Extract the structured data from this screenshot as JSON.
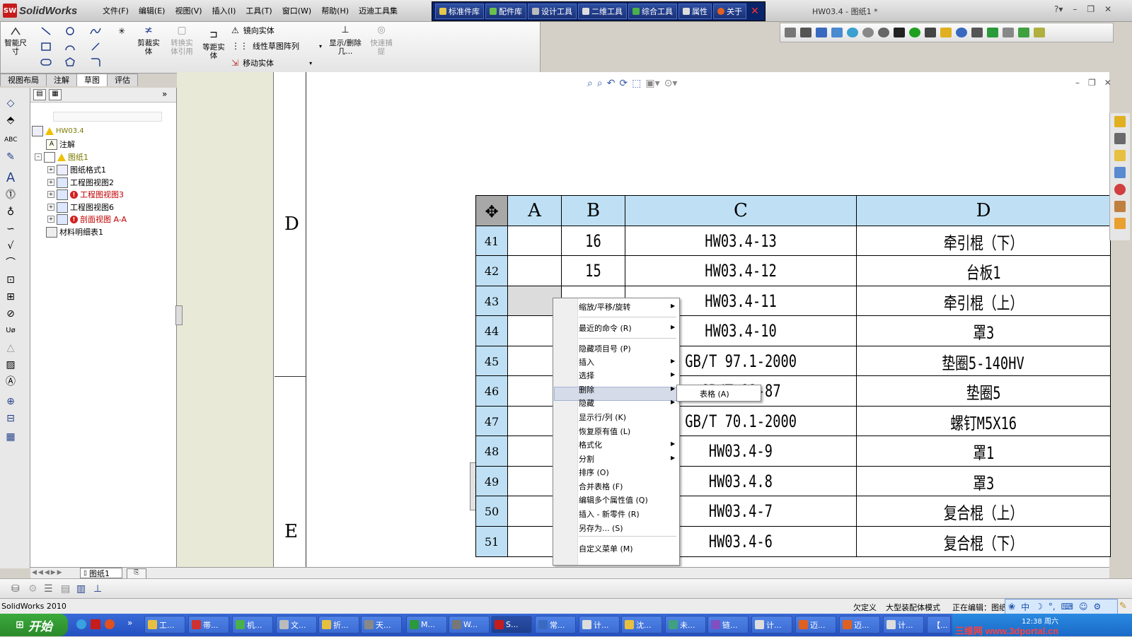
{
  "app": {
    "name": "SolidWorks",
    "doc_title": "HW03.4 - 图纸1 *",
    "menus": [
      "文件(F)",
      "编辑(E)",
      "视图(V)",
      "插入(I)",
      "工具(T)",
      "窗口(W)",
      "帮助(H)",
      "迈迪工具集"
    ],
    "plugin_bar": [
      "标准件库",
      "配件库",
      "设计工具",
      "二维工具",
      "综合工具",
      "属性",
      "关于"
    ]
  },
  "command_manager": {
    "tools": {
      "smart_dim": "智能尺寸",
      "trim": "剪裁实体",
      "convert": "转换实体引用",
      "offset": "等距实体",
      "mirror": "镜向实体",
      "linear_pattern": "线性草图阵列",
      "move": "移动实体",
      "show_delete": "显示/删除几...",
      "quick_snap": "快速捕捉"
    },
    "tabs": [
      "视图布局",
      "注解",
      "草图",
      "评估"
    ],
    "active_tab": "草图"
  },
  "feature_tree": {
    "root": "HW03.4",
    "annotations": "注解",
    "sheet": "图纸1",
    "items": [
      {
        "label": "图纸格式1",
        "state": "normal"
      },
      {
        "label": "工程图视图2",
        "state": "normal"
      },
      {
        "label": "工程图视图3",
        "state": "error"
      },
      {
        "label": "工程图视图6",
        "state": "normal"
      },
      {
        "label": "剖面视图 A-A",
        "state": "error"
      },
      {
        "label": "材料明细表1",
        "state": "normal"
      }
    ]
  },
  "drawing": {
    "zone_letters": [
      "D",
      "E"
    ]
  },
  "bom_table": {
    "columns": [
      "A",
      "B",
      "C",
      "D"
    ],
    "rows": [
      {
        "row": "41",
        "A": "",
        "B": "16",
        "C": "HW03.4-13",
        "D": "牵引棍（下）"
      },
      {
        "row": "42",
        "A": "",
        "B": "15",
        "C": "HW03.4-12",
        "D": "台板1"
      },
      {
        "row": "43",
        "A": "",
        "B": "",
        "C": "HW03.4-11",
        "D": "牵引棍（上）"
      },
      {
        "row": "44",
        "A": "",
        "B": "",
        "C": "HW03.4-10",
        "D": "罩3"
      },
      {
        "row": "45",
        "A": "",
        "B": "",
        "C": "GB/T 97.1-2000",
        "D": "垫圈5-140HV"
      },
      {
        "row": "46",
        "A": "",
        "B": "",
        "C": "GB/T 93-87",
        "D": "垫圈5"
      },
      {
        "row": "47",
        "A": "",
        "B": "",
        "C": "GB/T 70.1-2000",
        "D": "螺钉M5X16"
      },
      {
        "row": "48",
        "A": "",
        "B": "",
        "C": "HW03.4-9",
        "D": "罩1"
      },
      {
        "row": "49",
        "A": "",
        "B": "",
        "C": "HW03.4.8",
        "D": "罩3"
      },
      {
        "row": "50",
        "A": "",
        "B": "",
        "C": "HW03.4-7",
        "D": "复合棍（上）"
      },
      {
        "row": "51",
        "A": "",
        "B": "",
        "C": "HW03.4-6",
        "D": "复合棍（下）"
      }
    ]
  },
  "context_menu": {
    "items": [
      {
        "label": "缩放/平移/旋转",
        "sub": true
      },
      {
        "label": "最近的命令 (R)",
        "sub": true
      },
      {
        "label": "隐藏项目号 (P)",
        "sub": false
      },
      {
        "label": "插入",
        "sub": true
      },
      {
        "label": "选择",
        "sub": true
      },
      {
        "label": "删除",
        "sub": true
      },
      {
        "label": "隐藏",
        "sub": true
      },
      {
        "label": "显示行/列 (K)",
        "sub": false
      },
      {
        "label": "恢复原有值 (L)",
        "sub": false
      },
      {
        "label": "格式化",
        "sub": true
      },
      {
        "label": "分割",
        "sub": true
      },
      {
        "label": "排序 (O)",
        "sub": false
      },
      {
        "label": "合并表格 (F)",
        "sub": false
      },
      {
        "label": "编辑多个属性值 (Q)",
        "sub": false
      },
      {
        "label": "插入 - 新零件 (R)",
        "sub": false
      },
      {
        "label": "另存为... (S)",
        "sub": false
      },
      {
        "label": "自定义菜单 (M)",
        "sub": false
      }
    ],
    "submenu_label": "表格 (A)"
  },
  "sheet_tab": "图纸1",
  "status": {
    "left": "SolidWorks 2010",
    "underdefined": "欠定义",
    "mode": "大型装配体模式",
    "editing": "正在编辑：图纸"
  },
  "taskbar": {
    "start": "开始",
    "items": [
      "工...",
      "帯...",
      "机...",
      "文...",
      "折...",
      "天...",
      "M...",
      "W...",
      "S...",
      "常...",
      "计...",
      "沈...",
      "未...",
      "链...",
      "计...",
      "迈...",
      "迈...",
      "计...",
      "【..."
    ],
    "time": "12:38 周六",
    "watermark": "三维网 www.3dportal.cn"
  },
  "colors": {
    "table_header": "#bfe0f4",
    "plugin_bar": "#0a246a",
    "taskbar": "#2350c0"
  }
}
